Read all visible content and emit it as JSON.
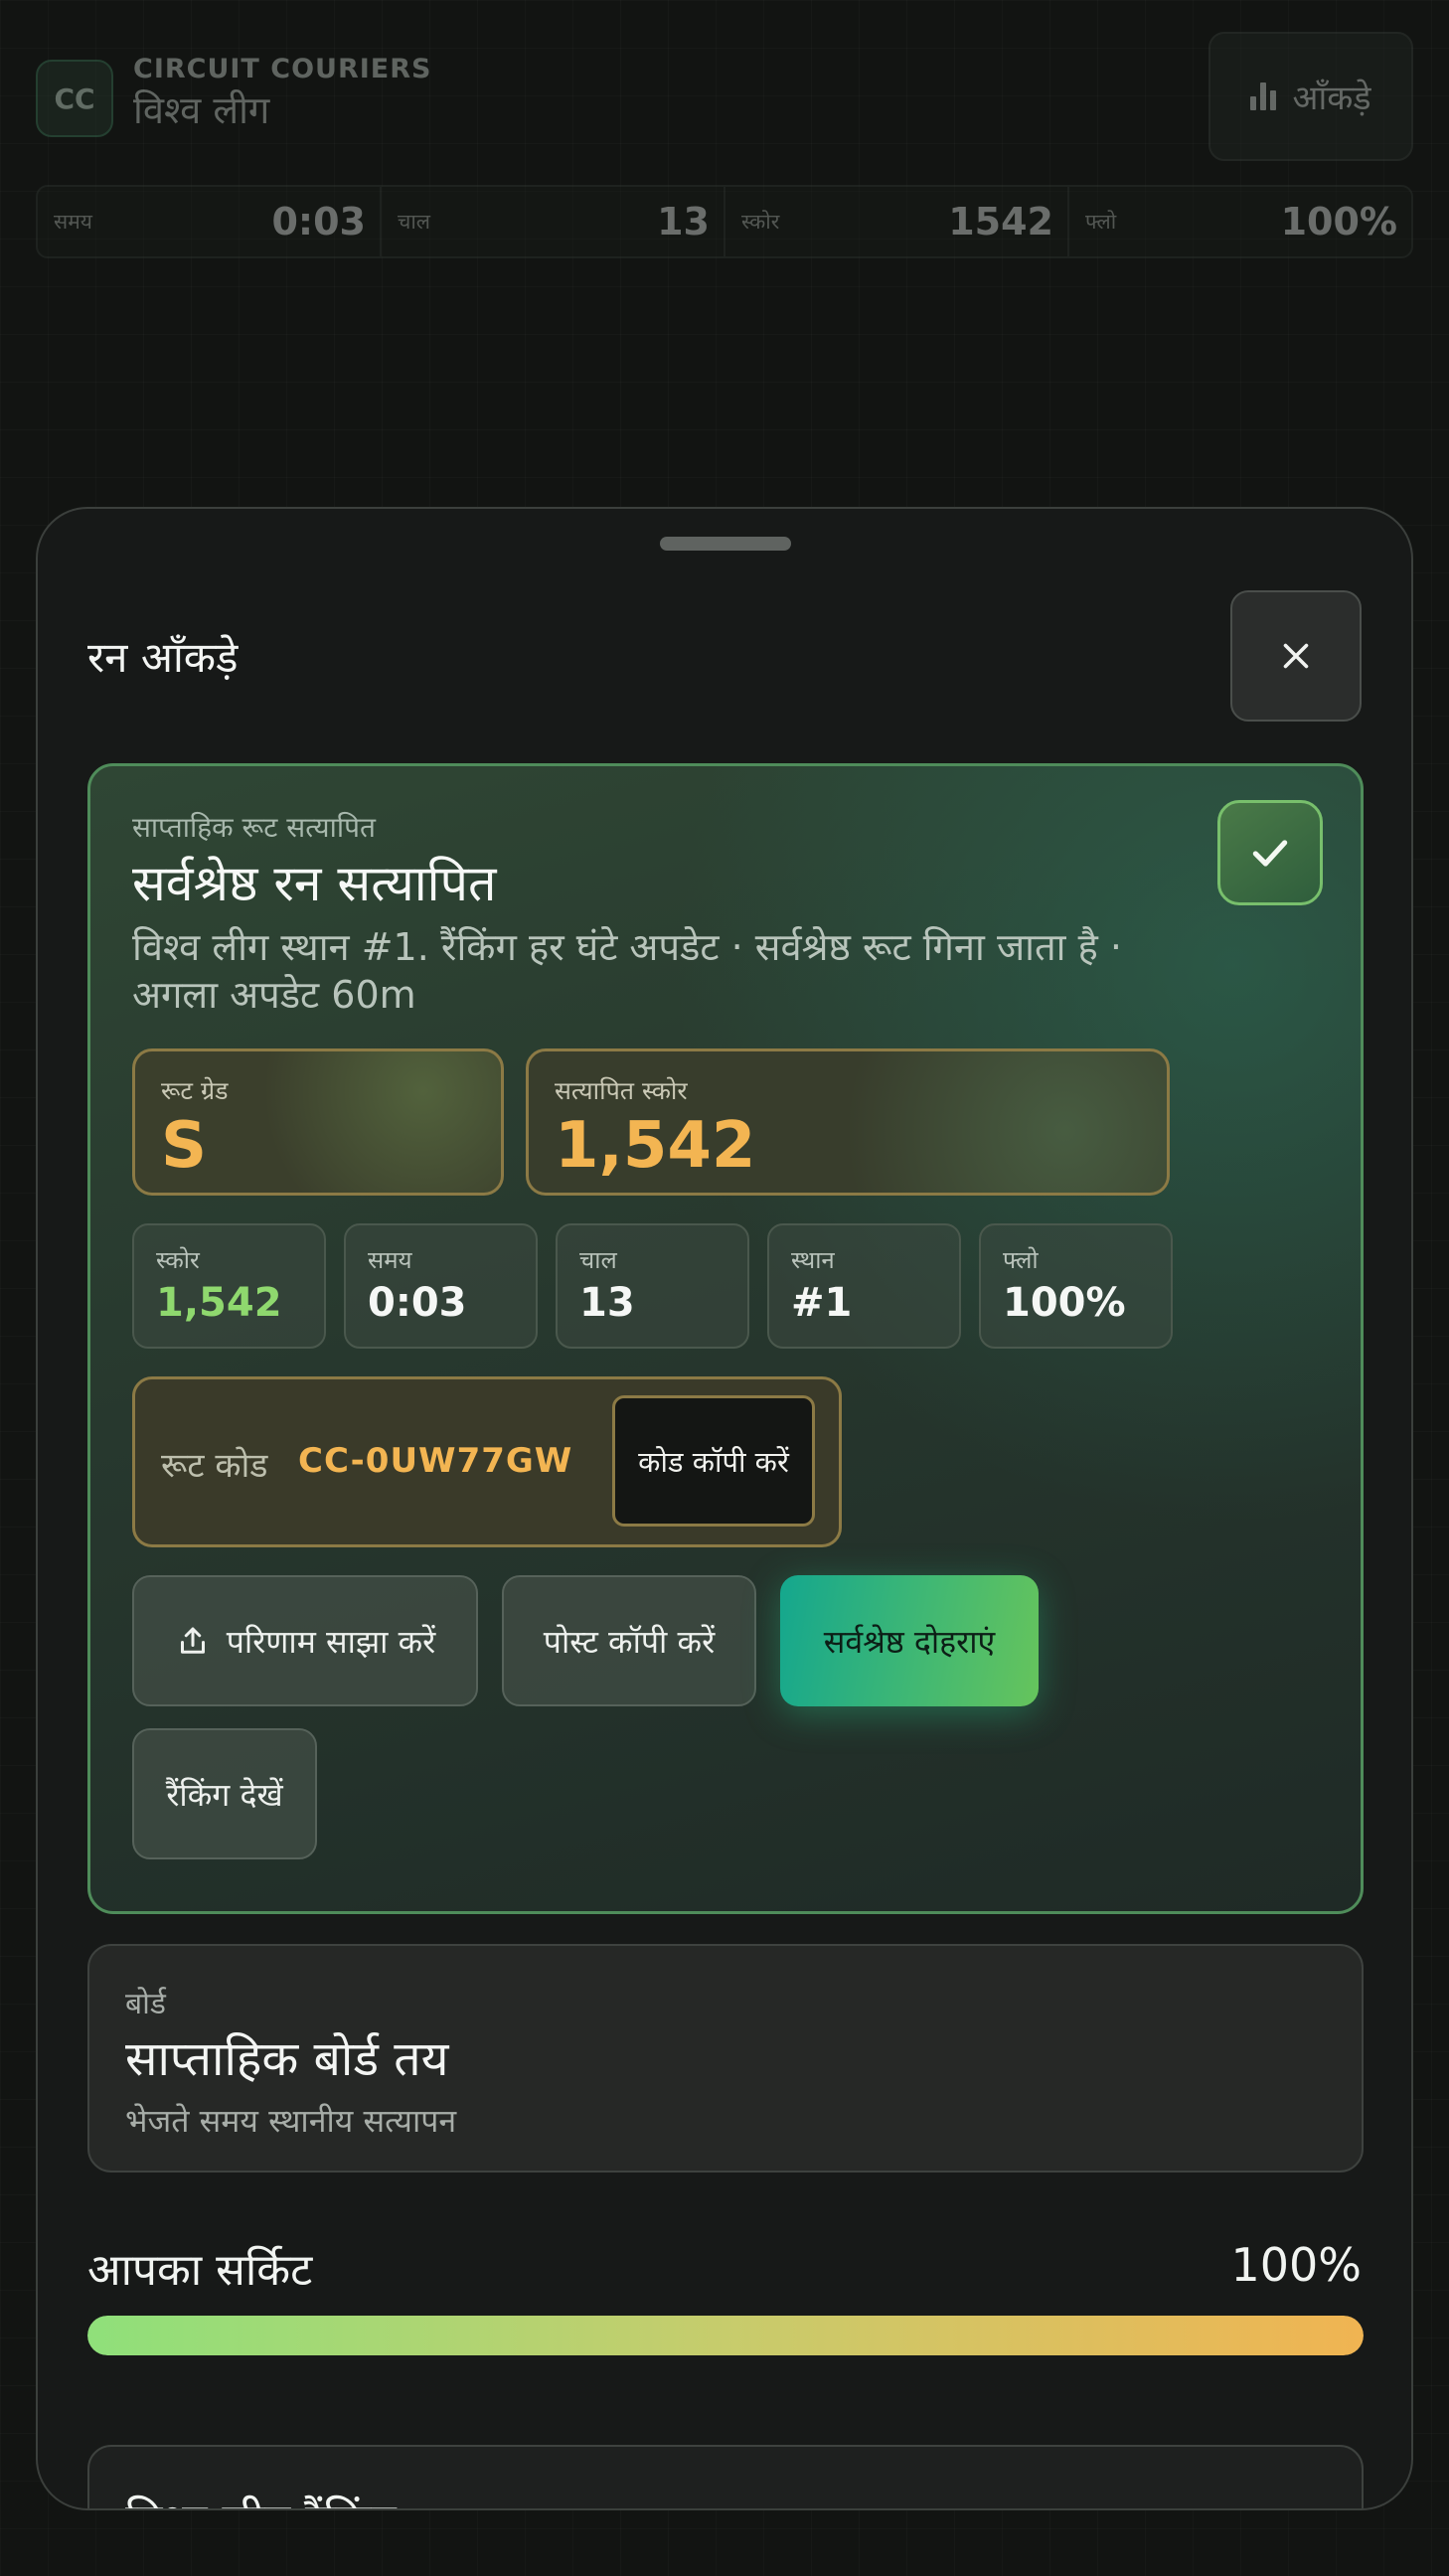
{
  "app": {
    "logo_initials": "CC",
    "brand": "CIRCUIT COURIERS",
    "subtitle": "विश्व लीग",
    "stats_button_label": "आँकड़े"
  },
  "top_stats": [
    {
      "label": "समय",
      "value": "0:03"
    },
    {
      "label": "चाल",
      "value": "13"
    },
    {
      "label": "स्कोर",
      "value": "1542"
    },
    {
      "label": "फ्लो",
      "value": "100%"
    }
  ],
  "sheet": {
    "title": "रन आँकड़े",
    "close_icon": "close-icon"
  },
  "hero": {
    "kicker": "साप्ताहिक रूट सत्यापित",
    "title": "सर्वश्रेष्ठ रन सत्यापित",
    "description": "विश्व लीग स्थान #1. रैंकिंग हर घंटे अपडेट · सर्वश्रेष्ठ रूट गिना जाता है · अगला अपडेट 60m",
    "grade_label": "रूट ग्रेड",
    "grade_value": "S",
    "score_label": "सत्यापित स्कोर",
    "score_value": "1,542",
    "mini_stats": [
      {
        "label": "स्कोर",
        "value": "1,542"
      },
      {
        "label": "समय",
        "value": "0:03"
      },
      {
        "label": "चाल",
        "value": "13"
      },
      {
        "label": "स्थान",
        "value": "#1"
      },
      {
        "label": "फ्लो",
        "value": "100%"
      }
    ],
    "route_code_label": "रूट कोड",
    "route_code": "CC-0UW77GW",
    "copy_code_label": "कोड कॉपी करें",
    "share_label": "परिणाम साझा करें",
    "copy_post_label": "पोस्ट कॉपी करें",
    "replay_label": "सर्वश्रेष्ठ दोहराएं",
    "ranking_label": "रैंकिंग देखें"
  },
  "board": {
    "kicker": "बोर्ड",
    "title": "साप्ताहिक बोर्ड तय",
    "subtitle": "भेजते समय स्थानीय सत्यापन"
  },
  "circuit": {
    "label": "आपका सर्किट",
    "percent_text": "100%",
    "progress": 1.0
  },
  "next_section": {
    "title": "विश्व लीग रैंकिंग"
  },
  "colors": {
    "accent_gold": "#f3b552",
    "accent_green": "#8fd86e",
    "cta_gradient_start": "#14a78e",
    "cta_gradient_end": "#66c45c"
  }
}
